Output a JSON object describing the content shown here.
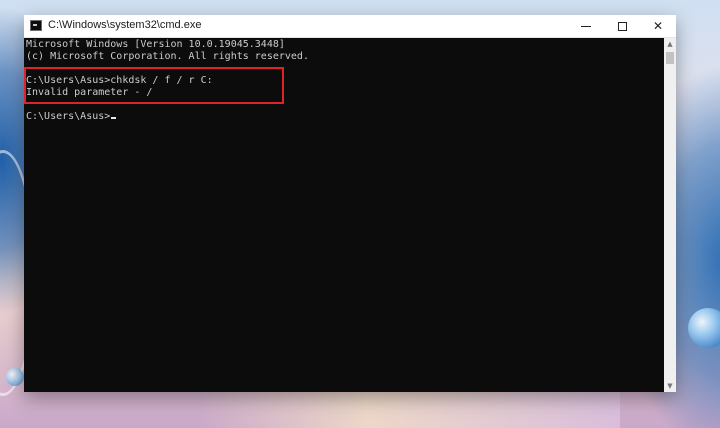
{
  "window": {
    "title": "C:\\Windows\\system32\\cmd.exe",
    "icon": "cmd-icon",
    "controls": {
      "minimize_icon": "minimize-icon",
      "maximize_icon": "maximize-icon",
      "close_icon": "close-icon",
      "close_glyph": "✕"
    }
  },
  "console": {
    "lines": [
      "Microsoft Windows [Version 10.0.19045.3448]",
      "(c) Microsoft Corporation. All rights reserved.",
      "C:\\Users\\Asus>chkdsk / f / r C:",
      "Invalid parameter - /",
      "C:\\Users\\Asus>"
    ],
    "text_color": "#cccccc",
    "background": "#0c0c0c",
    "highlight_color": "#e02328"
  },
  "scrollbar": {
    "up_glyph": "▲",
    "down_glyph": "▼"
  }
}
